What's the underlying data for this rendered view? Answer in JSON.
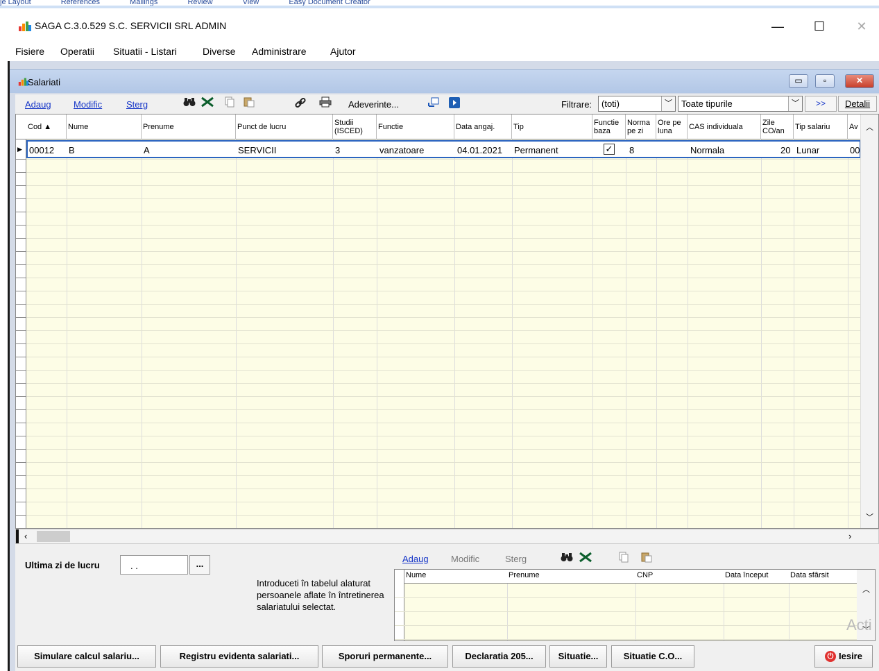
{
  "topstrip": {
    "items": [
      "je Layout",
      "References",
      "Mailings",
      "Review",
      "View",
      "Easy Document Creator"
    ]
  },
  "window": {
    "title": "SAGA C.3.0.529 S.C. SERVICII SRL  ADMIN",
    "minimize": "—",
    "maximize": "☐",
    "close": "✕"
  },
  "menu": [
    "Fisiere",
    "Operatii",
    "Situatii - Listari",
    "Diverse",
    "Administrare",
    "Ajutor"
  ],
  "child": {
    "title": "Salariati",
    "min": "▭",
    "max": "▫",
    "close": "✕"
  },
  "toolbar": {
    "add": "Adaug",
    "modify": "Modific",
    "delete": "Sterg",
    "adeverinte": "Adeverinte...",
    "filter_label": "Filtrare:",
    "filter_value": "(toti)",
    "type_value": "Toate tipurile",
    "next": ">>",
    "details": "Detalii"
  },
  "columns": [
    {
      "key": "cod",
      "label": "Cod ▲"
    },
    {
      "key": "nume",
      "label": "Nume"
    },
    {
      "key": "prenume",
      "label": "Prenume"
    },
    {
      "key": "punct",
      "label": "Punct de lucru"
    },
    {
      "key": "studii",
      "label": "Studii (ISCED)"
    },
    {
      "key": "functie",
      "label": "Functie"
    },
    {
      "key": "data",
      "label": "Data angaj."
    },
    {
      "key": "tip",
      "label": "Tip"
    },
    {
      "key": "fbaza",
      "label": "Functie baza"
    },
    {
      "key": "norma",
      "label": "Norma pe zi"
    },
    {
      "key": "ore",
      "label": "Ore pe luna"
    },
    {
      "key": "cas",
      "label": "CAS individuala"
    },
    {
      "key": "zile",
      "label": "Zile CO/an"
    },
    {
      "key": "tipsal",
      "label": "Tip salariu"
    },
    {
      "key": "av",
      "label": "Av"
    }
  ],
  "rows": [
    {
      "cod": "00012",
      "nume": "B",
      "prenume": "A",
      "punct": "SERVICII",
      "studii": "3",
      "functie": "vanzatoare",
      "data": "04.01.2021",
      "tip": "Permanent",
      "fbaza": true,
      "norma": "8",
      "ore": "",
      "cas": "Normala",
      "zile": "20",
      "tipsal": "Lunar",
      "av": "00"
    }
  ],
  "bottom": {
    "ultima_label": "Ultima zi de lucru",
    "ultima_value": ". .",
    "ultima_btn": "...",
    "intro": "Introduceti în tabelul alaturat persoanele aflate în întretinerea salariatului selectat.",
    "add": "Adaug",
    "modify": "Modific",
    "delete": "Sterg",
    "pcols": [
      "Nume",
      "Prenume",
      "CNP",
      "Data început",
      "Data sfârsit"
    ]
  },
  "buttons": [
    "Simulare calcul salariu...",
    "Registru evidenta salariati...",
    "Sporuri permanente...",
    "Declaratia 205...",
    "Situatie...",
    "Situatie C.O...",
    "Iesire"
  ],
  "watermark": "Acti"
}
